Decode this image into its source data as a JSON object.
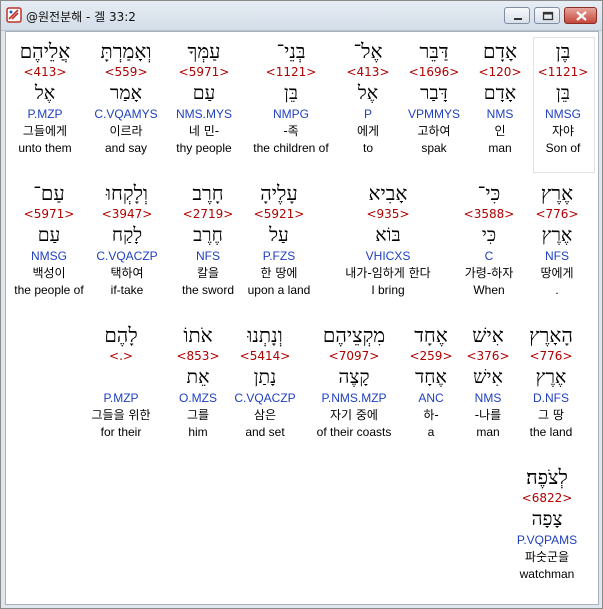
{
  "window": {
    "title": "@원전분해 - 겔 33:2"
  },
  "rows": [
    [
      {
        "heb": "בֶּן",
        "strong": "<1121>",
        "lemma": "בֵּן",
        "parse": "NMSG",
        "kor": "자야",
        "eng": "Son of",
        "selected": true
      },
      {
        "heb": "אָדָם",
        "strong": "<120>",
        "lemma": "אָדָם",
        "parse": "NMS",
        "kor": "인",
        "eng": "man"
      },
      {
        "heb": "דַּבֵּר",
        "strong": "<1696>",
        "lemma": "דָּבַר",
        "parse": "VPMMYS",
        "kor": "고하여",
        "eng": "spak"
      },
      {
        "heb": "אֶל־",
        "strong": "<413>",
        "lemma": "אֶל",
        "parse": "P",
        "kor": "에게",
        "eng": "to"
      },
      {
        "heb": "בְּנֵי־",
        "strong": "<1121>",
        "lemma": "בֵּן",
        "parse": "NMPG",
        "kor": "-족",
        "eng": "the children of"
      },
      {
        "heb": "עַמְּךָ",
        "strong": "<5971>",
        "lemma": "עַם",
        "parse": "NMS.MYS",
        "kor": "네 민-",
        "eng": "thy people"
      },
      {
        "heb": "וְאָמַרְתָּ",
        "strong": "<559>",
        "lemma": "אָמַר",
        "parse": "C.VQAMYS",
        "kor": "이르라",
        "eng": "and say"
      },
      {
        "heb": "אֲלֵיהֶם",
        "strong": "<413>",
        "lemma": "אֶל",
        "parse": "P.MZP",
        "kor": "그들에게",
        "eng": "unto them"
      }
    ],
    [
      {
        "heb": "אֶרֶץ",
        "strong": "<776>",
        "lemma": "אֶרֶץ",
        "parse": "NFS",
        "kor": "땅에게",
        "eng": "."
      },
      {
        "heb": "כִּי־",
        "strong": "<3588>",
        "lemma": "כִּי",
        "parse": "C",
        "kor": "가령-하자",
        "eng": "When"
      },
      {
        "heb": "אָבִיא",
        "strong": "<935>",
        "lemma": "בּוֹא",
        "parse": "VHICXS",
        "kor": "내가-임하게 한다",
        "eng": "I bring"
      },
      {
        "heb": "עָלֶיהָ",
        "strong": "<5921>",
        "lemma": "עַל",
        "parse": "P.FZS",
        "kor": "한 땅에",
        "eng": "upon a land"
      },
      {
        "heb": "חָרֶב",
        "strong": "<2719>",
        "lemma": "חֶרֶב",
        "parse": "NFS",
        "kor": "칼을",
        "eng": "the sword"
      },
      {
        "heb": "וְלָקְחוּ",
        "strong": "<3947>",
        "lemma": "לָקַח",
        "parse": "C.VQACZP",
        "kor": "택하여",
        "eng": "if-take"
      },
      {
        "heb": "עַם־",
        "strong": "<5971>",
        "lemma": "עַם",
        "parse": "NMSG",
        "kor": "백성이",
        "eng": "the people of"
      }
    ],
    [
      {
        "heb": "הָאָרֶץ",
        "strong": "<776>",
        "lemma": "אֶרֶץ",
        "parse": "D.NFS",
        "kor": "그 땅",
        "eng": "the land"
      },
      {
        "heb": "אִישׁ",
        "strong": "<376>",
        "lemma": "אִישׁ",
        "parse": "NMS",
        "kor": "-나를",
        "eng": "man"
      },
      {
        "heb": "אֶחָד",
        "strong": "<259>",
        "lemma": "אֶחָד",
        "parse": "ANC",
        "kor": "하-",
        "eng": "a"
      },
      {
        "heb": "מִקְצֵיהֶם",
        "strong": "<7097>",
        "lemma": "קָצֶה",
        "parse": "P.NMS.MZP",
        "kor": "자기 중에",
        "eng": "of their coasts"
      },
      {
        "heb": "וְנָתְנוּ",
        "strong": "<5414>",
        "lemma": "נָתַן",
        "parse": "C.VQACZP",
        "kor": "삼은",
        "eng": "and set"
      },
      {
        "heb": "אֹתוֹ",
        "strong": "<853>",
        "lemma": "אֵת",
        "parse": "O.MZS",
        "kor": "그를",
        "eng": "him"
      },
      {
        "heb": "לָהֶם",
        "strong": "<.>",
        "lemma": "",
        "parse": "P.MZP",
        "kor": "그들을 위한",
        "eng": "for their"
      }
    ],
    [
      {
        "heb": "לְצֹפֶה׃",
        "strong": "<6822>",
        "lemma": "צָפָה",
        "parse": "P.VQPAMS",
        "kor": "파숫군을",
        "eng": "watchman"
      }
    ]
  ]
}
